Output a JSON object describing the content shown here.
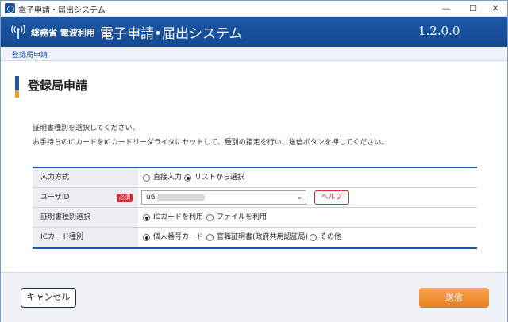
{
  "window": {
    "title": "電子申請・届出システム",
    "controls": {
      "minimize": "—",
      "maximize": "☐",
      "close": "✕"
    }
  },
  "header": {
    "ministry": "総務省 電波利用",
    "system_name": "電子申請•届出システム",
    "version": "1.2.0.0",
    "color": "#1d57a6"
  },
  "breadcrumb": "登録局申請",
  "page": {
    "title": "登録局申請",
    "instructions": [
      "証明書種別を選択してください。",
      "お手持ちのICカードをICカードリーダライタにセットして、種別の指定を行い、送信ボタンを押してください。"
    ]
  },
  "form": {
    "input_method": {
      "label": "入力方式",
      "options": [
        "直接入力",
        "リストから選択"
      ],
      "selected": "リストから選択"
    },
    "user_id": {
      "label": "ユーザID",
      "required_badge": "必須",
      "value": "u6",
      "help_label": "ヘルプ"
    },
    "cert_type": {
      "label": "証明書種別選択",
      "options": [
        "ICカードを利用",
        "ファイルを利用"
      ],
      "selected": "ICカードを利用"
    },
    "ic_card_type": {
      "label": "ICカード種別",
      "options": [
        "個人番号カード",
        "官職証明書(政府共用認証局)",
        "その他"
      ],
      "selected": "個人番号カード"
    }
  },
  "footer": {
    "cancel_label": "キャンセル",
    "submit_label": "送信",
    "submit_color": "#ef8a2c"
  }
}
